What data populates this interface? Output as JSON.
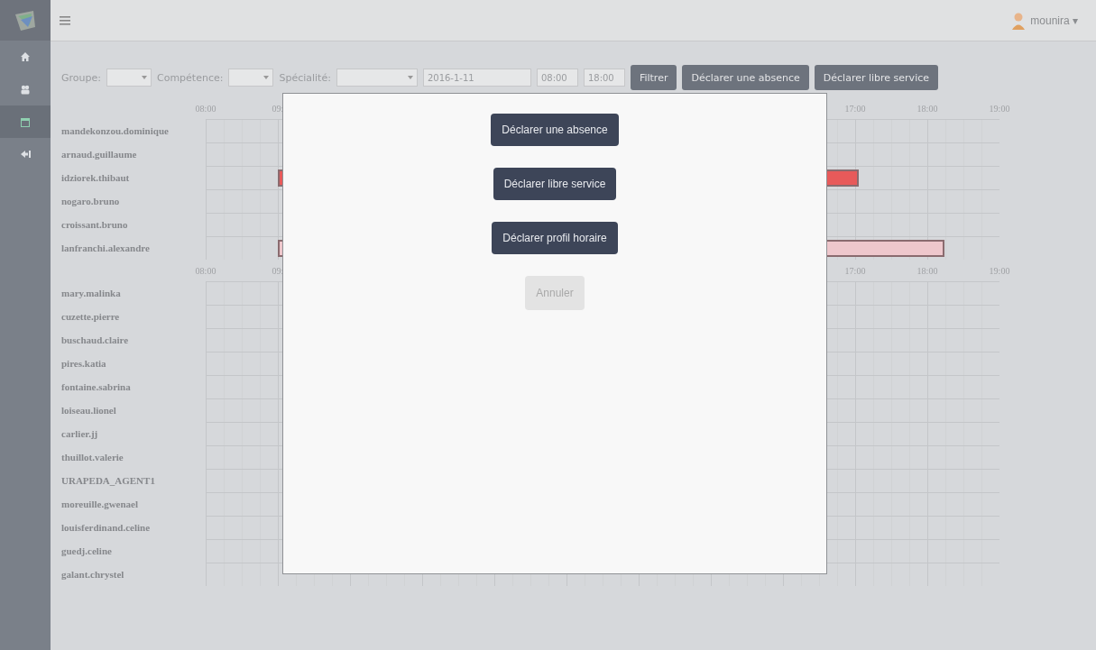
{
  "sidebar": {
    "items": [
      {
        "kind": "home",
        "selected": false
      },
      {
        "kind": "team",
        "selected": false
      },
      {
        "kind": "calendar",
        "selected": true
      },
      {
        "kind": "logout",
        "selected": false
      }
    ]
  },
  "topbar": {
    "user": "mounira ▾"
  },
  "filters": {
    "group_label": "Groupe:",
    "competence_label": "Compétence:",
    "specialite_label": "Spécialité:",
    "date": "2016-1-11",
    "start": "08:00",
    "end": "18:00",
    "buttons": [
      "Filtrer",
      "Déclarer une absence",
      "Déclarer libre service"
    ]
  },
  "planning": {
    "groups": [
      {
        "header": {
          "left": [
            "08:00",
            "09:"
          ],
          "right": [
            "17:00",
            "18:00",
            "19:00"
          ]
        },
        "rows": [
          {
            "name": "mandekonzou.dominique"
          },
          {
            "name": "arnaud.guillaume"
          },
          {
            "name": "idziorek.thibaut",
            "bar": {
              "kind": "absence",
              "color": "#e85a5a"
            }
          },
          {
            "name": "nogaro.bruno"
          },
          {
            "name": "croissant.bruno"
          },
          {
            "name": "lanfranchi.alexandre",
            "bar": {
              "kind": "libre",
              "color": "#eec7cc"
            }
          }
        ]
      },
      {
        "header": {
          "left": [
            "08:00",
            "09:"
          ],
          "right": [
            "17:00",
            "18:00",
            "19:00"
          ]
        },
        "rows": [
          {
            "name": "mary.malinka"
          },
          {
            "name": "cuzette.pierre"
          },
          {
            "name": "buschaud.claire"
          },
          {
            "name": "pires.katia"
          },
          {
            "name": "fontaine.sabrina"
          },
          {
            "name": "loiseau.lionel"
          },
          {
            "name": "carlier.jj"
          },
          {
            "name": "thuillot.valerie"
          },
          {
            "name": "URAPEDA_AGENT1"
          },
          {
            "name": "moreuille.gwenael"
          },
          {
            "name": "louisferdinand.celine"
          },
          {
            "name": "guedj.celine"
          },
          {
            "name": "galant.chrystel"
          }
        ]
      }
    ]
  },
  "modal": {
    "buttons": [
      {
        "label": "Déclarer une absence",
        "kind": "primary"
      },
      {
        "label": "Déclarer libre service",
        "kind": "primary"
      },
      {
        "label": "Déclarer profil horaire",
        "kind": "primary"
      },
      {
        "label": "Annuler",
        "kind": "cancel"
      }
    ]
  }
}
